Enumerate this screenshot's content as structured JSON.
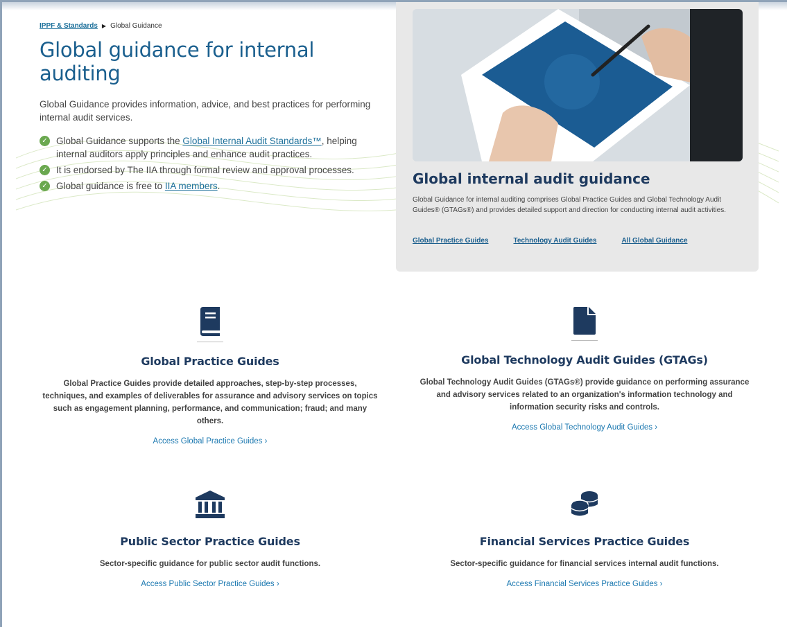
{
  "breadcrumb": {
    "parent": "IPPF & Standards",
    "current": "Global Guidance"
  },
  "hero": {
    "title": "Global guidance for internal auditing",
    "intro": "Global Guidance provides information, advice, and best practices for performing internal audit services.",
    "bullet1": {
      "before": "Global Guidance supports the ",
      "link": "Global Internal Audit Standards™",
      "after": ", helping internal auditors apply principles and enhance audit practices."
    },
    "bullet2": "It is endorsed by The IIA through formal review and approval processes.",
    "bullet3": {
      "before": "Global guidance is free to ",
      "link": "IIA members",
      "after": "."
    }
  },
  "card": {
    "title": "Global internal audit guidance",
    "text": "Global Guidance for internal auditing comprises Global Practice Guides and Global Technology Audit Guides® (GTAGs®) and provides detailed support and direction for conducting internal audit activities.",
    "links": [
      "Global Practice Guides",
      "Technology Audit Guides",
      "All Global Guidance"
    ]
  },
  "features": [
    {
      "icon": "book-icon",
      "title": "Global Practice Guides",
      "text": "Global Practice Guides provide detailed approaches, step-by-step processes, techniques, and examples of deliverables for assurance and advisory services on topics such as engagement planning, performance, and communication; fraud; and many others.",
      "link": "Access Global Practice Guides ›"
    },
    {
      "icon": "document-icon",
      "title": "Global Technology Audit Guides (GTAGs)",
      "text": "Global Technology Audit Guides (GTAGs®) provide guidance on performing assurance and advisory services related to an organization's information technology and information security risks and controls.",
      "link": "Access Global Technology Audit Guides ›"
    },
    {
      "icon": "landmark-icon",
      "title": "Public Sector Practice Guides",
      "text": "Sector-specific guidance for public sector audit functions.",
      "link": "Access Public Sector Practice Guides ›"
    },
    {
      "icon": "coins-icon",
      "title": "Financial Services Practice Guides",
      "text": "Sector-specific guidance for financial services internal audit functions.",
      "link": "Access Financial Services Practice Guides ›"
    }
  ],
  "colors": {
    "heading": "#1a5f8e",
    "link": "#1b78b0",
    "check": "#6aa84f",
    "card_bg": "#e8e8e8",
    "icon": "#1e3a5f"
  }
}
